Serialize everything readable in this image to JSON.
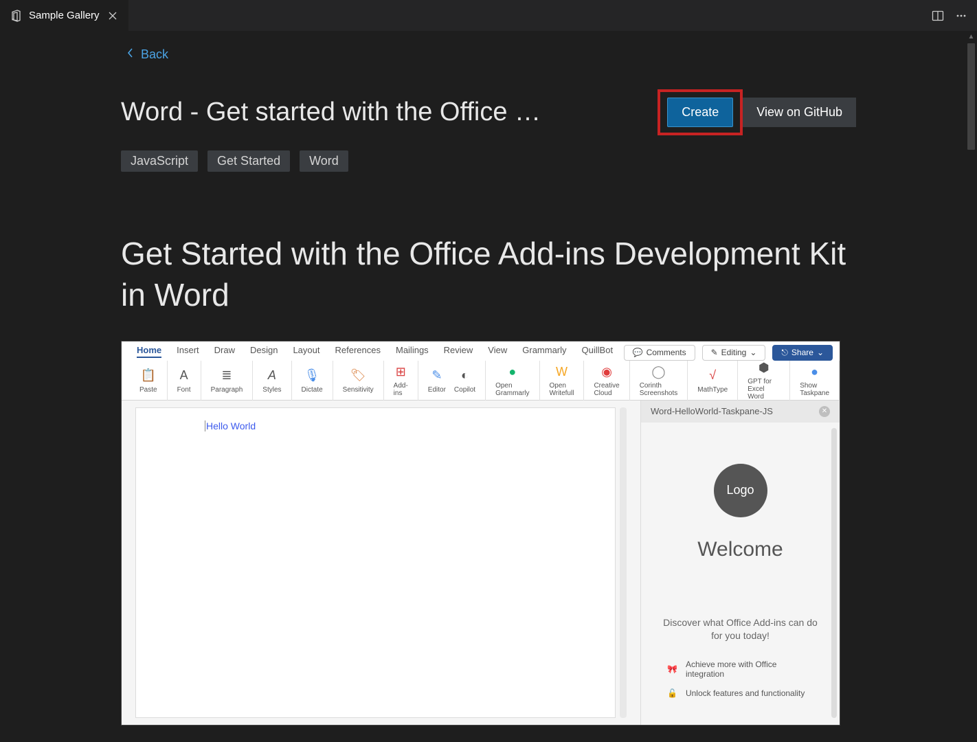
{
  "tab": {
    "title": "Sample Gallery"
  },
  "back": {
    "label": "Back"
  },
  "header": {
    "title": "Word - Get started with the Office …",
    "create_label": "Create",
    "github_label": "View on GitHub"
  },
  "tags": [
    "JavaScript",
    "Get Started",
    "Word"
  ],
  "article": {
    "heading": "Get Started with the Office Add-ins Development Kit in Word"
  },
  "preview": {
    "ribbon_tabs": [
      "Home",
      "Insert",
      "Draw",
      "Design",
      "Layout",
      "References",
      "Mailings",
      "Review",
      "View",
      "Grammarly",
      "QuillBot"
    ],
    "ribbon_active": "Home",
    "ribbon_tools": [
      "Paste",
      "Font",
      "Paragraph",
      "Styles",
      "Dictate",
      "Sensitivity",
      "Add-ins",
      "Editor",
      "Copilot",
      "Open Grammarly",
      "Open Writefull",
      "Creative Cloud",
      "Corinth Screenshots",
      "MathType",
      "GPT for Excel Word",
      "Show Taskpane"
    ],
    "ribbon_right": {
      "comments": "Comments",
      "editing": "Editing",
      "share": "Share"
    },
    "doc_text": "Hello World",
    "taskpane": {
      "title": "Word-HelloWorld-Taskpane-JS",
      "logo": "Logo",
      "welcome": "Welcome",
      "discover": "Discover what Office Add-ins can do for you today!",
      "features": [
        "Achieve more with Office integration",
        "Unlock features and functionality"
      ]
    }
  }
}
